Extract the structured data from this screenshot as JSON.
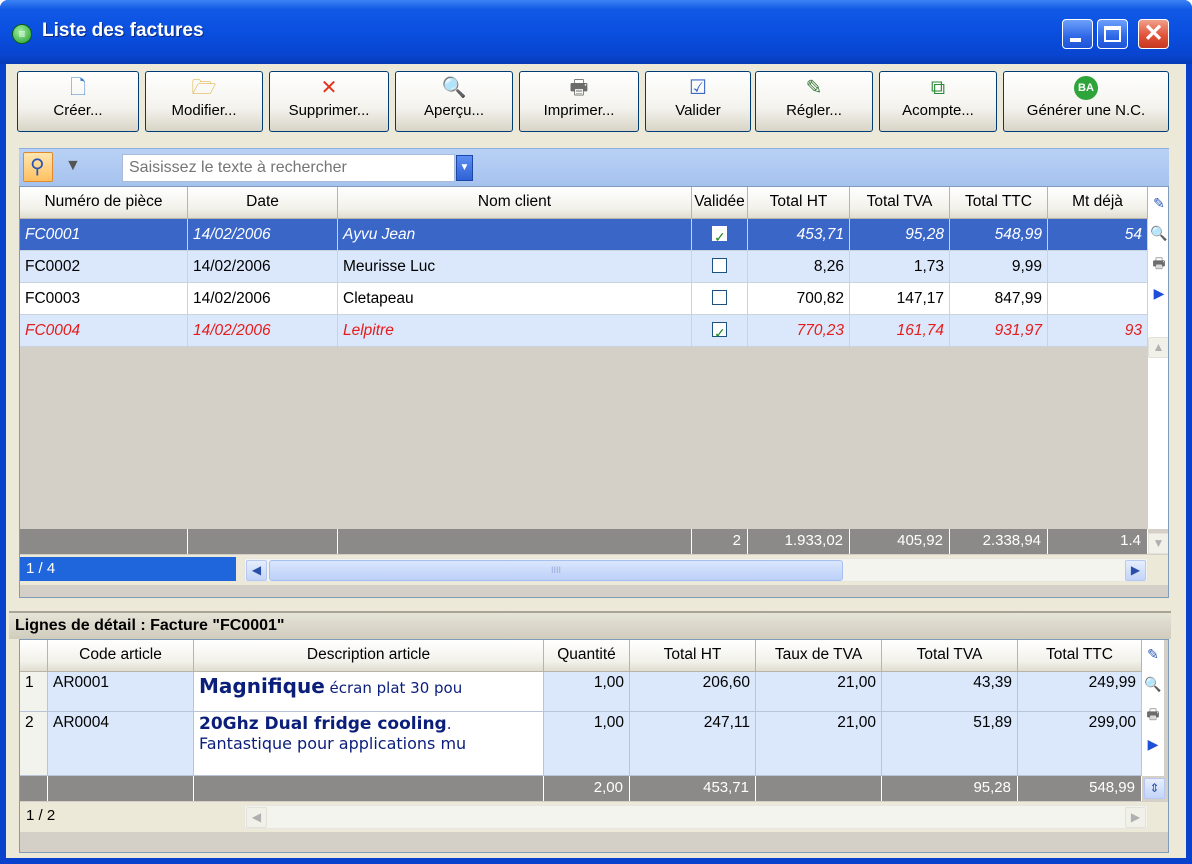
{
  "window": {
    "title": "Liste des factures",
    "close_glyph": "✕"
  },
  "toolbar": [
    {
      "label": "Créer...",
      "icon": "new-document-icon",
      "glyph": "🗋"
    },
    {
      "label": "Modifier...",
      "icon": "open-folder-icon",
      "glyph": "🗁"
    },
    {
      "label": "Supprimer...",
      "icon": "delete-x-icon",
      "glyph": "✕"
    },
    {
      "label": "Aperçu...",
      "icon": "preview-icon",
      "glyph": "🔍"
    },
    {
      "label": "Imprimer...",
      "icon": "printer-icon",
      "glyph": "🖶"
    },
    {
      "label": "Valider",
      "icon": "validate-icon",
      "glyph": "☑"
    },
    {
      "label": "Régler...",
      "icon": "payment-icon",
      "glyph": "✎"
    },
    {
      "label": "Acompte...",
      "icon": "deposit-icon",
      "glyph": "⧉"
    },
    {
      "label": "Générer une N.C.",
      "icon": "credit-note-icon",
      "glyph": "BA"
    }
  ],
  "search": {
    "placeholder": "Saisissez le texte à rechercher",
    "search_glyph": "⚲",
    "filter_glyph": "▼",
    "combo_glyph": "▼"
  },
  "invoices": {
    "columns": [
      "Numéro de pièce",
      "Date",
      "Nom client",
      "Validée",
      "Total HT",
      "Total TVA",
      "Total TTC",
      "Mt déjà"
    ],
    "rows": [
      {
        "numero": "FC0001",
        "date": "14/02/2006",
        "client": "Ayvu Jean",
        "validee": true,
        "total_ht": "453,71",
        "total_tva": "95,28",
        "total_ttc": "548,99",
        "mt_deja": "54"
      },
      {
        "numero": "FC0002",
        "date": "14/02/2006",
        "client": "Meurisse Luc",
        "validee": false,
        "total_ht": "8,26",
        "total_tva": "1,73",
        "total_ttc": "9,99",
        "mt_deja": ""
      },
      {
        "numero": "FC0003",
        "date": "14/02/2006",
        "client": "Cletapeau",
        "validee": false,
        "total_ht": "700,82",
        "total_tva": "147,17",
        "total_ttc": "847,99",
        "mt_deja": ""
      },
      {
        "numero": "FC0004",
        "date": "14/02/2006",
        "client": "Lelpitre",
        "validee": true,
        "total_ht": "770,23",
        "total_tva": "161,74",
        "total_ttc": "931,97",
        "mt_deja": "93"
      }
    ],
    "totals": {
      "validee": "2",
      "total_ht": "1.933,02",
      "total_tva": "405,92",
      "total_ttc": "2.338,94",
      "mt_deja": "1.4"
    },
    "pager": "1 / 4",
    "scroll_grip": "IIII",
    "scroll_left": "◀",
    "scroll_right": "▶"
  },
  "details": {
    "title": "Lignes de détail : Facture \"FC0001\"",
    "columns": [
      "Code article",
      "Description article",
      "Quantité",
      "Total HT",
      "Taux de TVA",
      "Total TVA",
      "Total TTC"
    ],
    "rows": [
      {
        "n": "1",
        "code": "AR0001",
        "desc_bold": "Magnifique",
        "desc_rest": " écran plat 30 pou",
        "desc_line2": "",
        "quantite": "1,00",
        "total_ht": "206,60",
        "taux_tva": "21,00",
        "total_tva": "43,39",
        "total_ttc": "249,99"
      },
      {
        "n": "2",
        "code": "AR0004",
        "desc_bold": "20Ghz Dual fridge cooling",
        "desc_rest": ".",
        "desc_line2": "Fantastique pour applications mu",
        "quantite": "1,00",
        "total_ht": "247,11",
        "taux_tva": "21,00",
        "total_tva": "51,89",
        "total_ttc": "299,00"
      }
    ],
    "totals": {
      "quantite": "2,00",
      "total_ht": "453,71",
      "total_tva": "95,28",
      "total_ttc": "548,99"
    },
    "pager": "1 / 2"
  },
  "side_icons": [
    {
      "name": "edit-grid-icon",
      "glyph": "✎"
    },
    {
      "name": "preview-side-icon",
      "glyph": "🔍"
    },
    {
      "name": "print-side-icon",
      "glyph": "🖶"
    },
    {
      "name": "play-arrow-icon",
      "glyph": "▶"
    }
  ]
}
